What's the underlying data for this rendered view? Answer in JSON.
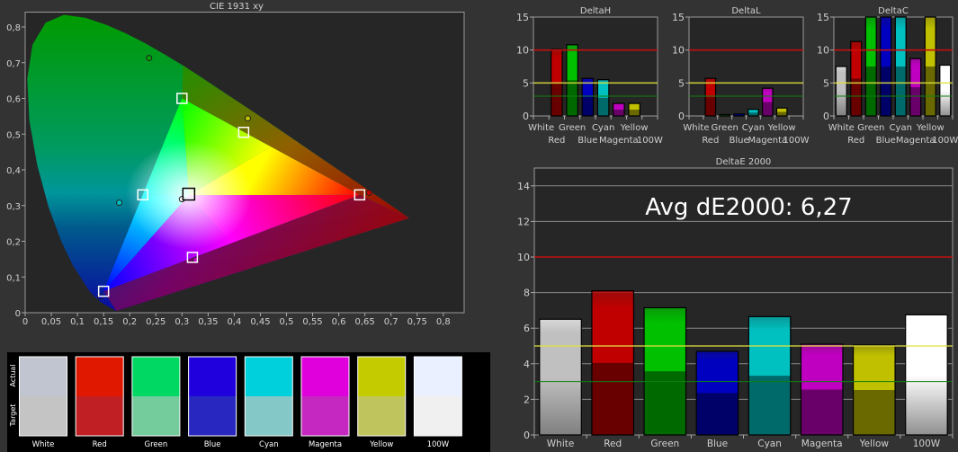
{
  "cie": {
    "title": "CIE 1931 xy",
    "x_ticks": [
      "0",
      "0,05",
      "0,1",
      "0,15",
      "0,2",
      "0,25",
      "0,3",
      "0,35",
      "0,4",
      "0,45",
      "0,5",
      "0,55",
      "0,6",
      "0,65",
      "0,7",
      "0,75",
      "0,8"
    ],
    "y_ticks": [
      "0",
      "0,1",
      "0,2",
      "0,3",
      "0,4",
      "0,5",
      "0,6",
      "0,7",
      "0,8"
    ]
  },
  "swatches": {
    "row_labels": {
      "actual": "Actual",
      "target": "Target"
    },
    "items": [
      {
        "label": "White",
        "actual": "#c0c5cf",
        "target": "#c4c4c4"
      },
      {
        "label": "Red",
        "actual": "#e01800",
        "target": "#c02024"
      },
      {
        "label": "Green",
        "actual": "#00d864",
        "target": "#74cc9c"
      },
      {
        "label": "Blue",
        "actual": "#2000dc",
        "target": "#2828c0"
      },
      {
        "label": "Cyan",
        "actual": "#00d0dc",
        "target": "#84c8c8"
      },
      {
        "label": "Magenta",
        "actual": "#e000dc",
        "target": "#c428c0"
      },
      {
        "label": "Yellow",
        "actual": "#c4cc00",
        "target": "#c0c45c"
      },
      {
        "label": "100W",
        "actual": "#eaf0ff",
        "target": "#f0f0f0"
      }
    ]
  },
  "chart_data": [
    {
      "type": "scatter",
      "title": "CIE 1931 xy",
      "xlim": [
        0,
        0.84
      ],
      "ylim": [
        0,
        0.84
      ],
      "series": [
        {
          "name": "measured",
          "marker": "square",
          "points": [
            {
              "label": "White",
              "x": 0.313,
              "y": 0.332
            },
            {
              "label": "Red",
              "x": 0.64,
              "y": 0.33
            },
            {
              "label": "Green",
              "x": 0.3,
              "y": 0.6
            },
            {
              "label": "Blue",
              "x": 0.15,
              "y": 0.06
            },
            {
              "label": "Cyan",
              "x": 0.225,
              "y": 0.33
            },
            {
              "label": "Magenta",
              "x": 0.32,
              "y": 0.155
            },
            {
              "label": "Yellow",
              "x": 0.418,
              "y": 0.505
            }
          ]
        },
        {
          "name": "target",
          "marker": "circle",
          "points": [
            {
              "label": "White",
              "x": 0.3,
              "y": 0.318,
              "color": "#ffffff"
            },
            {
              "label": "Red",
              "x": 0.658,
              "y": 0.336,
              "color": "#c00000"
            },
            {
              "label": "Green",
              "x": 0.237,
              "y": 0.713,
              "color": "#00a000"
            },
            {
              "label": "Blue",
              "x": 0.144,
              "y": 0.045,
              "color": "#0000c0"
            },
            {
              "label": "Cyan",
              "x": 0.18,
              "y": 0.308,
              "color": "#00c0c0"
            },
            {
              "label": "Magenta",
              "x": 0.326,
              "y": 0.148,
              "color": "#c000c0"
            },
            {
              "label": "Yellow",
              "x": 0.426,
              "y": 0.544,
              "color": "#c0c000"
            }
          ]
        }
      ]
    },
    {
      "type": "bar",
      "title": "DeltaH",
      "ylim": [
        0,
        15
      ],
      "yticks": [
        "0",
        "5",
        "10",
        "15"
      ],
      "categories": [
        "White",
        "Red",
        "Green",
        "Blue",
        "Cyan",
        "Magenta",
        "Yellow",
        "100W"
      ],
      "values": [
        0,
        10.1,
        10.8,
        5.7,
        5.5,
        1.9,
        1.9,
        0
      ],
      "reference_lines": [
        10,
        5,
        3
      ]
    },
    {
      "type": "bar",
      "title": "DeltaL",
      "ylim": [
        0,
        15
      ],
      "yticks": [
        "0",
        "5",
        "10",
        "15"
      ],
      "categories": [
        "White",
        "Red",
        "Green",
        "Blue",
        "Cyan",
        "Magenta",
        "Yellow",
        "100W"
      ],
      "values": [
        0,
        5.7,
        0.2,
        0.3,
        1.0,
        4.2,
        1.2,
        0
      ],
      "reference_lines": [
        10,
        5,
        3
      ]
    },
    {
      "type": "bar",
      "title": "DeltaC",
      "ylim": [
        0,
        15
      ],
      "yticks": [
        "0",
        "5",
        "10",
        "15"
      ],
      "categories": [
        "White",
        "Red",
        "Green",
        "Blue",
        "Cyan",
        "Magenta",
        "Yellow",
        "100W"
      ],
      "values": [
        7.5,
        11.3,
        15,
        15,
        15,
        8.7,
        15,
        7.7
      ],
      "reference_lines": [
        10,
        5,
        3
      ]
    },
    {
      "type": "bar",
      "title": "DeltaE 2000",
      "ylim": [
        0,
        15
      ],
      "yticks": [
        "0",
        "2",
        "4",
        "6",
        "8",
        "10",
        "12",
        "14"
      ],
      "categories": [
        "White",
        "Red",
        "Green",
        "Blue",
        "Cyan",
        "Magenta",
        "Yellow",
        "100W"
      ],
      "values": [
        6.5,
        8.1,
        7.15,
        4.7,
        6.65,
        5.1,
        5.05,
        6.75
      ],
      "reference_lines": [
        10,
        5,
        3
      ],
      "annotation": "Avg dE2000: 6,27"
    }
  ],
  "colors": {
    "background": "#333333",
    "plot_bg": "#262626",
    "ref_red": "#c01010",
    "ref_yellow": "#e0e040",
    "ref_green": "#108010",
    "bars": [
      "#c0c0c0",
      "#c00000",
      "#00c000",
      "#0000c0",
      "#00c0c0",
      "#c000c0",
      "#c0c000",
      "#ffffff"
    ]
  }
}
